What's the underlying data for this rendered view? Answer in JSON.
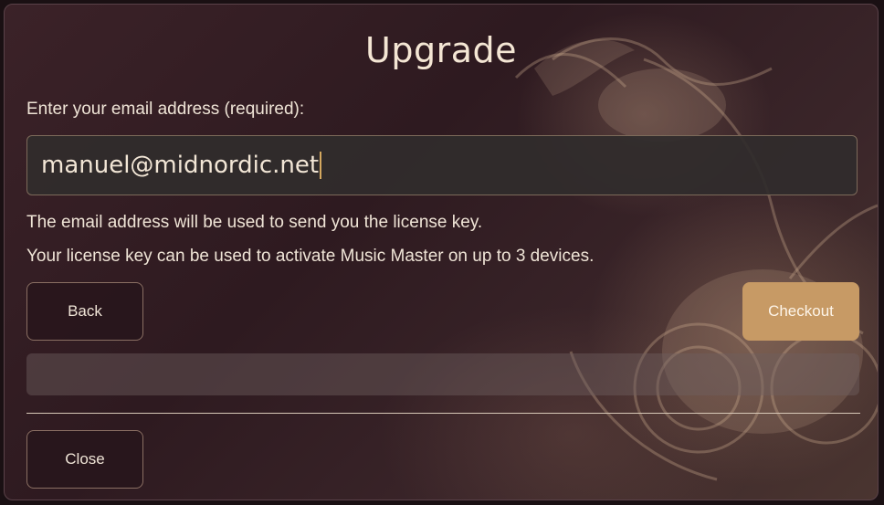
{
  "dialog": {
    "title": "Upgrade",
    "email_label": "Enter your email address (required):",
    "email_value": "manuel@midnordic.net",
    "info_line_1": "The email address will be used to send you the license key.",
    "info_line_2": "Your license key can be used to activate Music Master on up to 3 devices.",
    "back_label": "Back",
    "checkout_label": "Checkout",
    "close_label": "Close",
    "progress": 0
  },
  "colors": {
    "accent": "#c79a65",
    "text": "#efe4d6",
    "background": "#2e1a20",
    "caret": "#d4a85f"
  }
}
